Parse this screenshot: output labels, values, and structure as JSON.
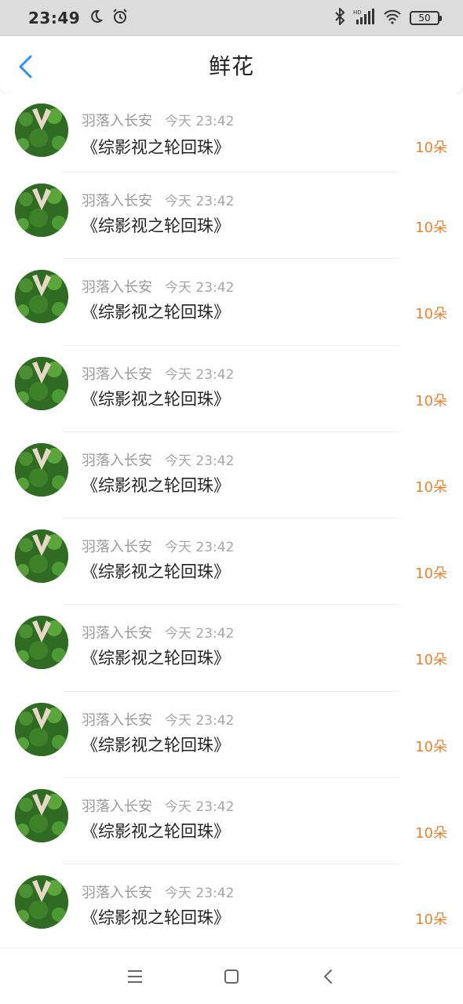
{
  "status_bar": {
    "time": "23:49",
    "battery": "50",
    "signal_label": "HD",
    "icons": [
      "moon-icon",
      "alarm-icon",
      "bluetooth-icon",
      "signal-icon",
      "wifi-icon",
      "battery-icon"
    ]
  },
  "header": {
    "title": "鲜花",
    "back_icon": "chevron-left-icon",
    "accent_color": "#2f8ff0"
  },
  "items": [
    {
      "username": "羽落入长安",
      "time": "今天 23:42",
      "book": "《综影视之轮回珠》",
      "count": "10朵"
    },
    {
      "username": "羽落入长安",
      "time": "今天 23:42",
      "book": "《综影视之轮回珠》",
      "count": "10朵"
    },
    {
      "username": "羽落入长安",
      "time": "今天 23:42",
      "book": "《综影视之轮回珠》",
      "count": "10朵"
    },
    {
      "username": "羽落入长安",
      "time": "今天 23:42",
      "book": "《综影视之轮回珠》",
      "count": "10朵"
    },
    {
      "username": "羽落入长安",
      "time": "今天 23:42",
      "book": "《综影视之轮回珠》",
      "count": "10朵"
    },
    {
      "username": "羽落入长安",
      "time": "今天 23:42",
      "book": "《综影视之轮回珠》",
      "count": "10朵"
    },
    {
      "username": "羽落入长安",
      "time": "今天 23:42",
      "book": "《综影视之轮回珠》",
      "count": "10朵"
    },
    {
      "username": "羽落入长安",
      "time": "今天 23:42",
      "book": "《综影视之轮回珠》",
      "count": "10朵"
    },
    {
      "username": "羽落入长安",
      "time": "今天 23:42",
      "book": "《综影视之轮回珠》",
      "count": "10朵"
    },
    {
      "username": "羽落入长安",
      "time": "今天 23:42",
      "book": "《综影视之轮回珠》",
      "count": "10朵"
    }
  ],
  "nav_bar": {
    "icons": [
      "menu-icon",
      "home-square-icon",
      "back-triangle-icon"
    ]
  },
  "colors": {
    "count_color": "#e9822f",
    "status_bar_bg": "#dcdcdc"
  }
}
